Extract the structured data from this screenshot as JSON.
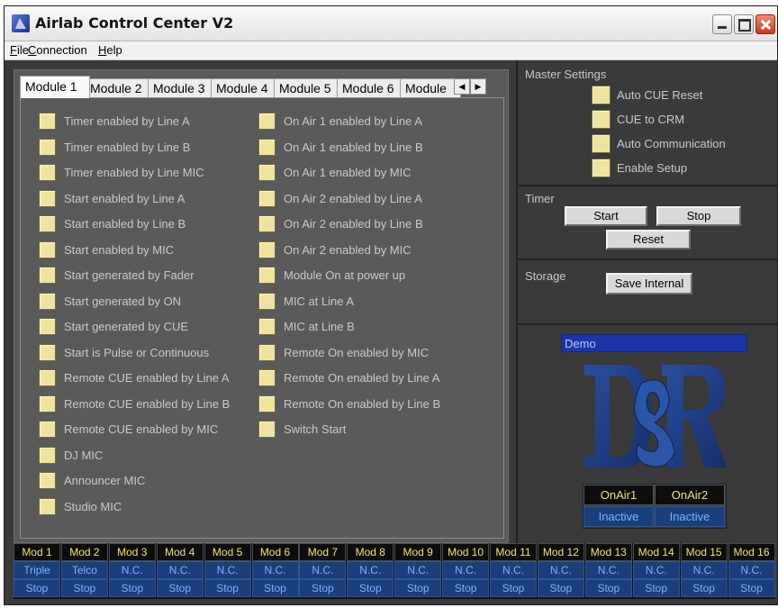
{
  "window": {
    "title": "Airlab Control Center V2"
  },
  "menu": [
    {
      "label": "File",
      "key": "F"
    },
    {
      "label": "Connection",
      "key": "C"
    },
    {
      "label": "Help",
      "key": "H"
    }
  ],
  "tabs": [
    "Module 1",
    "Module 2",
    "Module 3",
    "Module 4",
    "Module 5",
    "Module 6",
    "Module"
  ],
  "left_options": [
    "Timer enabled by Line A",
    "Timer enabled by Line B",
    "Timer enabled by Line MIC",
    "Start  enabled by Line A",
    "Start  enabled by Line B",
    "Start  enabled by MIC",
    "Start generated by Fader",
    "Start generated by ON",
    "Start generated by CUE",
    "Start is Pulse or Continuous",
    "Remote CUE enabled by Line A",
    "Remote CUE enabled by Line B",
    "Remote CUE enabled by MIC",
    "DJ MIC",
    "Announcer MIC",
    "Studio MIC"
  ],
  "right_options": [
    "On Air 1 enabled by Line A",
    "On Air 1 enabled by Line B",
    "On Air 1 enabled by  MIC",
    "On Air 2 enabled by Line A",
    "On Air 2 enabled by Line B",
    "On Air 2 enabled by MIC",
    "Module On at power up",
    "MIC at Line A",
    "MIC at Line B",
    "Remote On enabled by MIC",
    "Remote On enabled by Line A",
    "Remote On enabled by Line B",
    "Switch Start"
  ],
  "master": {
    "title": "Master Settings",
    "options": [
      "Auto CUE Reset",
      "CUE to CRM",
      "Auto Communication",
      "Enable Setup"
    ]
  },
  "timer": {
    "title": "Timer",
    "start": "Start",
    "stop": "Stop",
    "reset": "Reset"
  },
  "storage": {
    "title": "Storage",
    "save": "Save Internal"
  },
  "demo": "Demo",
  "onair": [
    {
      "label": "OnAir1",
      "status": "Inactive"
    },
    {
      "label": "OnAir2",
      "status": "Inactive"
    }
  ],
  "modules": [
    {
      "name": "Mod 1",
      "type": "Triple",
      "state": "Stop"
    },
    {
      "name": "Mod 2",
      "type": "Telco",
      "state": "Stop"
    },
    {
      "name": "Mod 3",
      "type": "N.C.",
      "state": "Stop"
    },
    {
      "name": "Mod 4",
      "type": "N.C.",
      "state": "Stop"
    },
    {
      "name": "Mod 5",
      "type": "N.C.",
      "state": "Stop"
    },
    {
      "name": "Mod 6",
      "type": "N.C.",
      "state": "Stop"
    },
    {
      "name": "Mod 7",
      "type": "N.C.",
      "state": "Stop"
    },
    {
      "name": "Mod 8",
      "type": "N.C.",
      "state": "Stop"
    },
    {
      "name": "Mod 9",
      "type": "N.C.",
      "state": "Stop"
    },
    {
      "name": "Mod 10",
      "type": "N.C.",
      "state": "Stop"
    },
    {
      "name": "Mod 11",
      "type": "N.C.",
      "state": "Stop"
    },
    {
      "name": "Mod 12",
      "type": "N.C.",
      "state": "Stop"
    },
    {
      "name": "Mod 13",
      "type": "N.C.",
      "state": "Stop"
    },
    {
      "name": "Mod 14",
      "type": "N.C.",
      "state": "Stop"
    },
    {
      "name": "Mod 15",
      "type": "N.C.",
      "state": "Stop"
    },
    {
      "name": "Mod 16",
      "type": "N.C.",
      "state": "Stop"
    }
  ],
  "colors": {
    "checkbox": "#efe3a0",
    "background": "#3a3a3a",
    "status_blue": "#1b3f7a",
    "status_text": "#7fb0ff",
    "module_name_text": "#efe27a"
  }
}
